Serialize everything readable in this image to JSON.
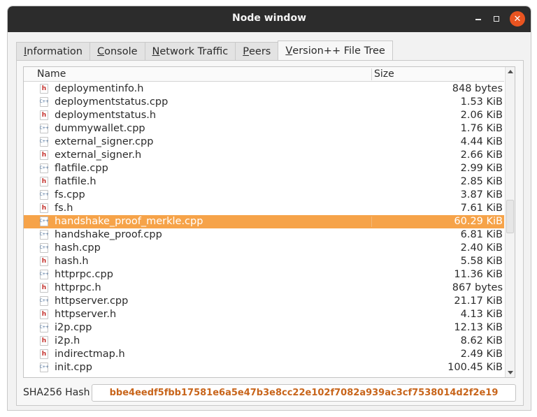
{
  "window": {
    "title": "Node window"
  },
  "tabs": [
    {
      "label": "Information",
      "accel": "I",
      "rest": "nformation"
    },
    {
      "label": "Console",
      "accel": "C",
      "rest": "onsole"
    },
    {
      "label": "Network Traffic",
      "accel": "N",
      "rest": "etwork Traffic"
    },
    {
      "label": "Peers",
      "accel": "P",
      "rest": "eers"
    },
    {
      "label": "Version++ File Tree",
      "accel": "V",
      "rest": "ersion++ File Tree"
    }
  ],
  "tree": {
    "headers": {
      "name": "Name",
      "size": "Size"
    },
    "rows": [
      {
        "name": "deploymentinfo.h",
        "size": "848 bytes",
        "type": "h"
      },
      {
        "name": "deploymentstatus.cpp",
        "size": "1.53 KiB",
        "type": "cpp"
      },
      {
        "name": "deploymentstatus.h",
        "size": "2.06 KiB",
        "type": "h"
      },
      {
        "name": "dummywallet.cpp",
        "size": "1.76 KiB",
        "type": "cpp"
      },
      {
        "name": "external_signer.cpp",
        "size": "4.44 KiB",
        "type": "cpp"
      },
      {
        "name": "external_signer.h",
        "size": "2.66 KiB",
        "type": "h"
      },
      {
        "name": "flatfile.cpp",
        "size": "2.99 KiB",
        "type": "cpp"
      },
      {
        "name": "flatfile.h",
        "size": "2.85 KiB",
        "type": "h"
      },
      {
        "name": "fs.cpp",
        "size": "3.87 KiB",
        "type": "cpp"
      },
      {
        "name": "fs.h",
        "size": "7.61 KiB",
        "type": "h"
      },
      {
        "name": "handshake_proof_merkle.cpp",
        "size": "60.29 KiB",
        "type": "cpp",
        "selected": true
      },
      {
        "name": "handshake_proof.cpp",
        "size": "6.81 KiB",
        "type": "cpp"
      },
      {
        "name": "hash.cpp",
        "size": "2.40 KiB",
        "type": "cpp"
      },
      {
        "name": "hash.h",
        "size": "5.58 KiB",
        "type": "h"
      },
      {
        "name": "httprpc.cpp",
        "size": "11.36 KiB",
        "type": "cpp"
      },
      {
        "name": "httprpc.h",
        "size": "867 bytes",
        "type": "h"
      },
      {
        "name": "httpserver.cpp",
        "size": "21.17 KiB",
        "type": "cpp"
      },
      {
        "name": "httpserver.h",
        "size": "4.13 KiB",
        "type": "h"
      },
      {
        "name": "i2p.cpp",
        "size": "12.13 KiB",
        "type": "cpp"
      },
      {
        "name": "i2p.h",
        "size": "8.62 KiB",
        "type": "h"
      },
      {
        "name": "indirectmap.h",
        "size": "2.49 KiB",
        "type": "h"
      },
      {
        "name": "init.cpp",
        "size": "100.45 KiB",
        "type": "cpp"
      }
    ]
  },
  "hash": {
    "label": "SHA256 Hash",
    "value": "bbe4eedf5fbb17581e6a5e47b3e8cc22e102f7082a939ac3cf7538014d2f2e19"
  },
  "icons": {
    "h_glyph": "h",
    "cpp_glyph": "C++"
  },
  "colors": {
    "selection": "#f6a349",
    "hash_text": "#c8651b",
    "close_button": "#e95420",
    "titlebar": "#2c2c2c"
  }
}
